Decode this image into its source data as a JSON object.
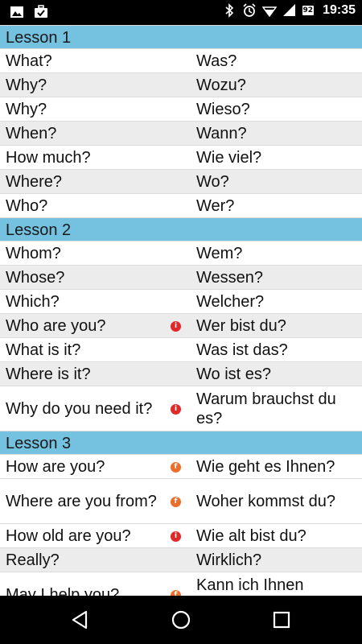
{
  "status_bar": {
    "time": "19:35",
    "battery": "92",
    "icons_left": [
      "image-icon",
      "briefcase-check-icon"
    ],
    "icons_right": [
      "bluetooth-icon",
      "alarm-icon",
      "wifi-icon",
      "signal-icon",
      "battery-icon"
    ]
  },
  "lessons": [
    {
      "title": "Lesson 1",
      "rows": [
        {
          "en": "What?",
          "de": "Was?",
          "bg": "white",
          "h": "h30",
          "info": ""
        },
        {
          "en": "Why?",
          "de": "Wozu?",
          "bg": "gray",
          "h": "h30",
          "info": ""
        },
        {
          "en": "Why?",
          "de": "Wieso?",
          "bg": "white",
          "h": "h30",
          "info": ""
        },
        {
          "en": "When?",
          "de": "Wann?",
          "bg": "gray",
          "h": "h30",
          "info": ""
        },
        {
          "en": "How much?",
          "de": "Wie viel?",
          "bg": "white",
          "h": "h30",
          "info": ""
        },
        {
          "en": "Where?",
          "de": "Wo?",
          "bg": "gray",
          "h": "h30",
          "info": ""
        },
        {
          "en": "Who?",
          "de": "Wer?",
          "bg": "white",
          "h": "h30",
          "info": ""
        }
      ]
    },
    {
      "title": "Lesson 2",
      "rows": [
        {
          "en": "Whom?",
          "de": "Wem?",
          "bg": "white",
          "h": "h30",
          "info": ""
        },
        {
          "en": "Whose?",
          "de": "Wessen?",
          "bg": "gray",
          "h": "h30",
          "info": ""
        },
        {
          "en": "Which?",
          "de": "Welcher?",
          "bg": "white",
          "h": "h30",
          "info": ""
        },
        {
          "en": "Who are you?",
          "de": "Wer bist du?",
          "bg": "gray",
          "h": "h30",
          "info": "red"
        },
        {
          "en": "What is it?",
          "de": "Was ist das?",
          "bg": "white",
          "h": "h30",
          "info": ""
        },
        {
          "en": "Where is it?",
          "de": "Wo ist es?",
          "bg": "gray",
          "h": "h30",
          "info": ""
        },
        {
          "en": "Why do you need it?",
          "de": "Warum brauchst du es?",
          "bg": "white",
          "h": "h56",
          "info": "red"
        }
      ]
    },
    {
      "title": "Lesson 3",
      "rows": [
        {
          "en": "How are you?",
          "de": "Wie geht es Ihnen?",
          "bg": "white",
          "h": "h30",
          "info": "orange"
        },
        {
          "en": "Where are you from?",
          "de": "Woher kommst du?",
          "bg": "white",
          "h": "h56",
          "info": "orange"
        },
        {
          "en": "How old are you?",
          "de": "Wie alt bist du?",
          "bg": "white",
          "h": "h30",
          "info": "red"
        },
        {
          "en": "Really?",
          "de": "Wirklich?",
          "bg": "gray",
          "h": "h30",
          "info": ""
        },
        {
          "en": "May I help you?",
          "de": "Kann ich Ihnen helfen?",
          "bg": "white",
          "h": "h56",
          "info": "orange"
        }
      ]
    }
  ],
  "nav": {
    "back": "back-icon",
    "home": "home-icon",
    "recents": "recents-icon"
  }
}
